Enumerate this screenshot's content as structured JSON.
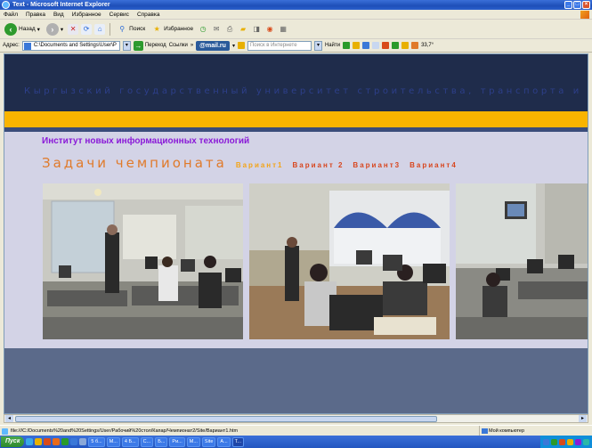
{
  "window": {
    "title": "Text - Microsoft Internet Explorer",
    "controls": {
      "minimize": "_",
      "maximize": "□",
      "close": "×"
    }
  },
  "menubar": {
    "items": [
      "Файл",
      "Правка",
      "Вид",
      "Избранное",
      "Сервис",
      "Справка"
    ]
  },
  "toolbar": {
    "back_label": "Назад",
    "search_label": "Поиск",
    "favorites_label": "Избранное"
  },
  "addressbar": {
    "label": "Адрес:",
    "value": "C:\\Documents and Settings\\User\\P",
    "go_label": "Переход",
    "links_label": "Ссылки",
    "mailru_label": "@mail.ru",
    "search_placeholder": "Поиск в Интернете",
    "find_label": "Найти",
    "temp_label": "33,7°"
  },
  "page": {
    "header_title": "Кыргызский государственный университет строительства, транспорта и архитектуры",
    "institute": "Институт новых информационных технологий",
    "tasks_title": "Задачи чемпионата",
    "variants": [
      {
        "label": "Вариант1",
        "active": true
      },
      {
        "label": "Вариант 2",
        "active": false
      },
      {
        "label": "Вариант3",
        "active": false
      },
      {
        "label": "Вариант4",
        "active": false
      }
    ],
    "colors": {
      "header_band": "#1f2c4b",
      "orange_band": "#f9b400",
      "institute_text": "#8a1ad8",
      "tasks_title": "#e07a2a",
      "variant_text": "#d8461e",
      "variant_active": "#f3a417",
      "bottom_band": "#5b6a8a"
    }
  },
  "statusbar": {
    "url": "file:///C:/Documents%20and%20Settings/User/Рабочий%20стол/Капар/Чемпионат2/Site/Вариант1.htm",
    "zone": "Мой компьютер"
  },
  "taskbar": {
    "start_label": "Пуск",
    "tasks": [
      "5 б...",
      "М...",
      "4 Б...",
      "С...",
      "Б...",
      "Ри...",
      "М...",
      "Site",
      "А...",
      "Т..."
    ],
    "active_index": 9
  }
}
